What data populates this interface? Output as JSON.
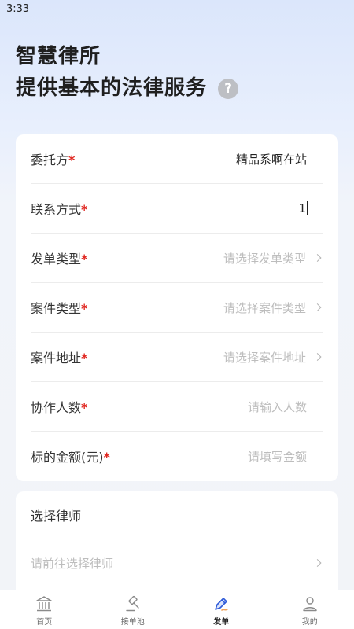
{
  "status_bar": {
    "time": "3:33"
  },
  "header": {
    "title_line1": "智慧律所",
    "title_line2": "提供基本的法律服务",
    "help_glyph": "?"
  },
  "form": {
    "required_mark": "*",
    "rows": [
      {
        "label": "委托方",
        "value": "精品系啊在站"
      },
      {
        "label": "联系方式",
        "value": "1"
      },
      {
        "label": "发单类型",
        "placeholder": "请选择发单类型"
      },
      {
        "label": "案件类型",
        "placeholder": "请选择案件类型"
      },
      {
        "label": "案件地址",
        "placeholder": "请选择案件地址"
      },
      {
        "label": "协作人数",
        "placeholder": "请输入人数"
      },
      {
        "label": "标的金额(元)",
        "placeholder": "请填写金额"
      }
    ]
  },
  "lawyer": {
    "title": "选择律师",
    "placeholder": "请前往选择律师"
  },
  "tabs": [
    {
      "label": "首页",
      "icon": "bank-icon"
    },
    {
      "label": "接单池",
      "icon": "gavel-icon"
    },
    {
      "label": "发单",
      "icon": "pen-icon",
      "active": true
    },
    {
      "label": "我的",
      "icon": "person-icon"
    }
  ],
  "colors": {
    "required": "#e0261f",
    "placeholder": "#bdbdbd",
    "active_icon": "#2f5bd8"
  }
}
